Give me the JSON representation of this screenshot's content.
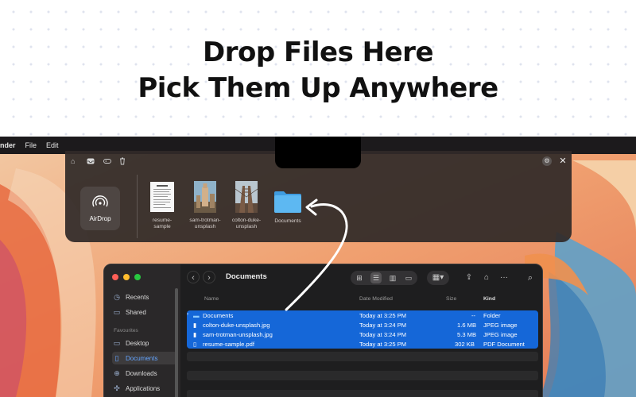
{
  "headline": {
    "line1": "Drop Files Here",
    "line2": "Pick Them Up Anywhere"
  },
  "menubar": {
    "items": [
      "nder",
      "File",
      "Edit"
    ]
  },
  "shelf": {
    "toolbar_icons": [
      "home-icon",
      "tray-icon",
      "gamepad-icon",
      "trash-icon"
    ],
    "airdrop_label": "AirDrop",
    "files": [
      {
        "name": "resume-\nsample",
        "line1": "resume-",
        "line2": "sample"
      },
      {
        "name": "sam-trotman-unsplash",
        "line1": "sam-trotman-",
        "line2": "unsplash"
      },
      {
        "name": "colton-duke-unsplash",
        "line1": "colton-duke-",
        "line2": "unsplash"
      },
      {
        "name": "Documents",
        "line1": "Documents",
        "line2": ""
      }
    ]
  },
  "finder": {
    "title": "Documents",
    "sidebar": {
      "top_items": [
        "Recents",
        "Shared"
      ],
      "heading": "Favourites",
      "fav_items": [
        "Desktop",
        "Documents",
        "Downloads",
        "Applications"
      ]
    },
    "columns": {
      "name": "Name",
      "date": "Date Modified",
      "size": "Size",
      "kind": "Kind"
    },
    "rows": [
      {
        "name": "Documents",
        "date": "Today at 3:25 PM",
        "size": "--",
        "kind": "Folder"
      },
      {
        "name": "colton-duke-unsplash.jpg",
        "date": "Today at 3:24 PM",
        "size": "1.6 MB",
        "kind": "JPEG image"
      },
      {
        "name": "sam-trotman-unsplash.jpg",
        "date": "Today at 3:24 PM",
        "size": "5.3 MB",
        "kind": "JPEG image"
      },
      {
        "name": "resume-sample.pdf",
        "date": "Today at 3:25 PM",
        "size": "302 KB",
        "kind": "PDF Document"
      }
    ]
  },
  "colors": {
    "selection": "#1567d8",
    "accent": "#64a5ff",
    "folder": "#4fb0f0"
  }
}
